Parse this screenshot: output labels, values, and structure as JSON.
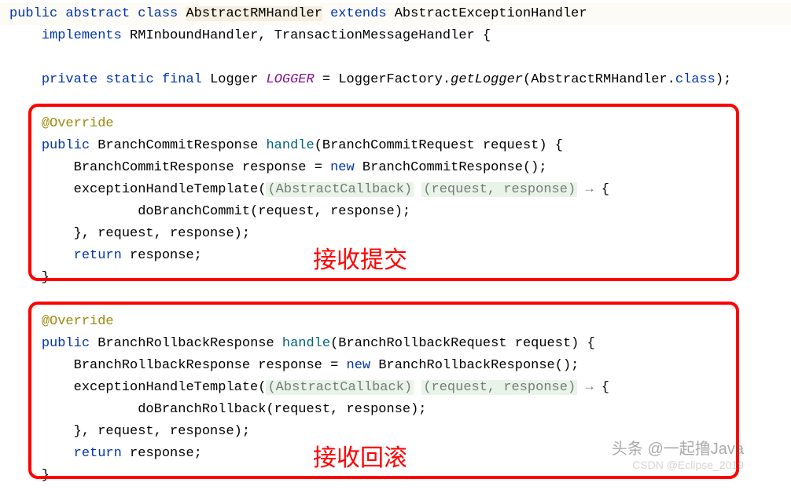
{
  "code": {
    "l1_public": "public",
    "l1_abstract": "abstract",
    "l1_class": "class",
    "l1_name": "AbstractRMHandler",
    "l1_extends": "extends",
    "l1_parent": "AbstractExceptionHandler",
    "l2_implements": "implements",
    "l2_if1": "RMInboundHandler",
    "l2_if2": "TransactionMessageHandler",
    "l4_private": "private",
    "l4_static": "static",
    "l4_final": "final",
    "l4_type": "Logger",
    "l4_field": "LOGGER",
    "l4_factory": "LoggerFactory",
    "l4_get": "getLogger",
    "l4_arg": "AbstractRMHandler",
    "l4_classkw": "class",
    "anno": "@Override",
    "m1_ret": "BranchCommitResponse",
    "m1_name": "handle",
    "m1_ptype": "BranchCommitRequest",
    "m1_pname": "request",
    "m1_vtype": "BranchCommitResponse",
    "m1_vname": "response",
    "m1_new": "new",
    "m1_ctor": "BranchCommitResponse",
    "m1_tmpl": "exceptionHandleTemplate",
    "hint_cb": "(AbstractCallback)",
    "hint_args": "(request, response)",
    "m1_do": "doBranchCommit",
    "ret": "return",
    "m2_ret": "BranchRollbackResponse",
    "m2_name": "handle",
    "m2_ptype": "BranchRollbackRequest",
    "m2_pname": "request",
    "m2_vtype": "BranchRollbackResponse",
    "m2_vname": "response",
    "m2_ctor": "BranchRollbackResponse",
    "m2_do": "doBranchRollback"
  },
  "labels": {
    "l1": "接收提交",
    "l2": "接收回滚"
  },
  "watermark": {
    "w1": "头条 @一起撸Java",
    "w2": "CSDN @Eclipse_2019"
  }
}
